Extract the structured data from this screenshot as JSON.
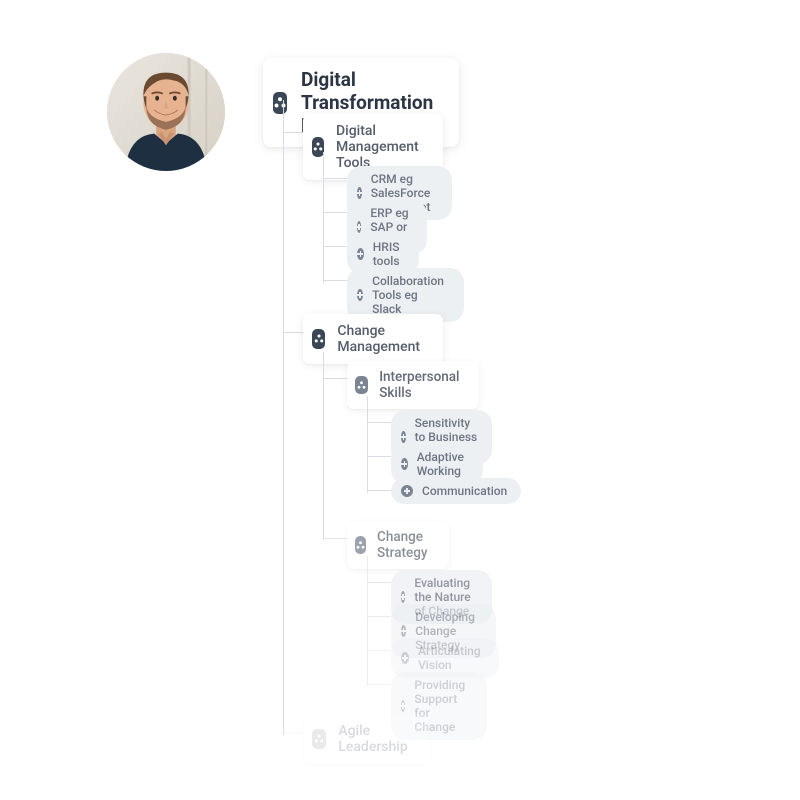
{
  "root": {
    "title": "Digital Transformation Manager"
  },
  "categories": [
    {
      "label": "Digital Management Tools",
      "skills": [
        "CRM eg SalesForce or Hubspot",
        "ERP eg SAP or Oracle",
        "HRIS tools",
        "Collaboration Tools eg Slack"
      ]
    },
    {
      "label": "Change Management",
      "subcategories": [
        {
          "label": "Interpersonal Skills",
          "skills": [
            "Sensitivity to Business Culture",
            "Adaptive Working",
            "Communication"
          ]
        },
        {
          "label": "Change Strategy",
          "skills": [
            "Evaluating the Nature of Change",
            "Developing Change Strategy",
            "Articulating Vision",
            "Providing Support for Change"
          ]
        }
      ]
    },
    {
      "label": "Agile Leadership"
    }
  ]
}
